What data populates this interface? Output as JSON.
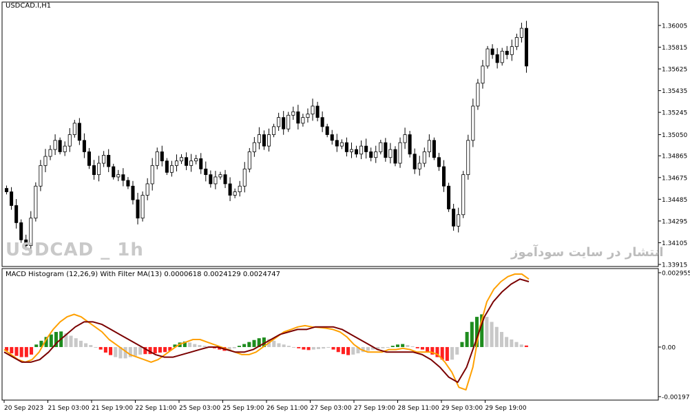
{
  "window": {
    "symbol_title": "USDCAD.I,H1",
    "watermark_left": "USDCAD _ 1h",
    "watermark_right": "انتشار در سایت سودآموز"
  },
  "colors": {
    "background": "#ffffff",
    "axis": "#000000",
    "candle": "#000000",
    "hist_green": "#1e8c1e",
    "hist_red": "#ff2020",
    "hist_grey": "#c8c8c8",
    "macd_line": "#ffa000",
    "signal_line": "#7a0000"
  },
  "chart_data": [
    {
      "type": "candlestick",
      "title": "USDCAD.I,H1",
      "yticks": [
        "1.36005",
        "1.35815",
        "1.35625",
        "1.35435",
        "1.35245",
        "1.35050",
        "1.34865",
        "1.34675",
        "1.34485",
        "1.34295",
        "1.34105",
        "1.33915"
      ],
      "ylim": [
        1.33915,
        1.36095
      ],
      "xticks": [
        "20 Sep 2023",
        "21 Sep 03:00",
        "21 Sep 19:00",
        "22 Sep 11:00",
        "25 Sep 03:00",
        "25 Sep 19:00",
        "26 Sep 11:00",
        "27 Sep 03:00",
        "27 Sep 19:00",
        "28 Sep 11:00",
        "29 Sep 03:00",
        "29 Sep 19:00"
      ],
      "close_path": [
        1.3455,
        1.3443,
        1.3428,
        1.3413,
        1.3408,
        1.3432,
        1.346,
        1.3478,
        1.3486,
        1.3492,
        1.35,
        1.349,
        1.3495,
        1.3505,
        1.3515,
        1.35,
        1.349,
        1.3478,
        1.347,
        1.348,
        1.3487,
        1.3477,
        1.3468,
        1.347,
        1.3465,
        1.346,
        1.3448,
        1.3432,
        1.3452,
        1.3462,
        1.3478,
        1.349,
        1.3482,
        1.3472,
        1.3478,
        1.3482,
        1.3485,
        1.3478,
        1.3482,
        1.3484,
        1.3475,
        1.347,
        1.3462,
        1.3468,
        1.347,
        1.3462,
        1.3452,
        1.3455,
        1.346,
        1.3475,
        1.349,
        1.3498,
        1.3505,
        1.3495,
        1.3505,
        1.3512,
        1.352,
        1.351,
        1.3522,
        1.3525,
        1.3515,
        1.352,
        1.3523,
        1.353,
        1.352,
        1.3512,
        1.3505,
        1.35,
        1.3495,
        1.3498,
        1.349,
        1.3492,
        1.3488,
        1.3495,
        1.349,
        1.3485,
        1.349,
        1.3498,
        1.3485,
        1.3492,
        1.348,
        1.3498,
        1.3505,
        1.3488,
        1.3475,
        1.348,
        1.349,
        1.35,
        1.3485,
        1.3477,
        1.346,
        1.344,
        1.3425,
        1.3435,
        1.347,
        1.35,
        1.353,
        1.355,
        1.3565,
        1.358,
        1.3575,
        1.3568,
        1.3578,
        1.3575,
        1.3582,
        1.359,
        1.3598,
        1.3565
      ]
    },
    {
      "type": "bar",
      "title": "MACD Histogram (12,26,9) With Filter MA(13) 0.0000618 0.0024129 0.0024747",
      "yticks": [
        "0.0029552",
        "0.00",
        "-0.0019719"
      ],
      "ylim": [
        -0.0019719,
        0.0029552
      ],
      "histogram": [
        -0.00015,
        -0.00025,
        -0.00035,
        -0.0004,
        -0.0004,
        -0.0003,
        0.0001,
        0.00025,
        0.0004,
        0.0005,
        0.0006,
        0.00062,
        0.00055,
        0.00045,
        0.00035,
        0.00025,
        0.00015,
        8e-05,
        0.0,
        -0.0001,
        -0.00022,
        -0.00032,
        -0.0004,
        -0.00045,
        -0.00045,
        -0.0004,
        -0.00035,
        -0.0003,
        -0.00028,
        -0.00028,
        -0.00025,
        -0.00022,
        -0.0002,
        -0.00015,
        0.0001,
        0.00018,
        0.00022,
        0.00018,
        0.00012,
        8e-05,
        5e-05,
        0.0,
        -5e-05,
        -0.0001,
        -0.00015,
        -0.00012,
        -5e-05,
        5e-05,
        0.00012,
        0.0002,
        0.00028,
        0.00035,
        0.00038,
        0.00032,
        0.00025,
        0.00015,
        0.0001,
        5e-05,
        0.0,
        -5e-05,
        -0.0001,
        -0.00012,
        -0.0001,
        -8e-05,
        -6e-05,
        -3e-05,
        -0.0001,
        -0.0002,
        -0.00028,
        -0.00032,
        -0.0003,
        -0.00025,
        -0.0002,
        -0.00015,
        -0.0001,
        -8e-05,
        -5e-05,
        -3e-05,
        5e-05,
        0.0001,
        0.00012,
        8e-05,
        3e-05,
        -5e-05,
        -0.0001,
        -0.00018,
        -0.0003,
        -0.0004,
        -0.0005,
        -0.00055,
        -0.0005,
        -0.0003,
        0.0002,
        0.0006,
        0.001,
        0.0012,
        0.0013,
        0.0012,
        0.001,
        0.0008,
        0.0006,
        0.0004,
        0.0003,
        0.0002,
        0.0001,
        6e-05
      ],
      "hist_colors": [
        "red",
        "red",
        "red",
        "red",
        "red",
        "red",
        "green",
        "green",
        "green",
        "green",
        "green",
        "green",
        "grey",
        "grey",
        "grey",
        "grey",
        "grey",
        "grey",
        "grey",
        "red",
        "red",
        "red",
        "grey",
        "grey",
        "grey",
        "grey",
        "grey",
        "grey",
        "red",
        "red",
        "red",
        "red",
        "red",
        "red",
        "green",
        "green",
        "green",
        "grey",
        "grey",
        "grey",
        "grey",
        "grey",
        "red",
        "red",
        "red",
        "grey",
        "grey",
        "green",
        "green",
        "green",
        "green",
        "green",
        "green",
        "grey",
        "grey",
        "grey",
        "grey",
        "grey",
        "grey",
        "red",
        "red",
        "red",
        "grey",
        "grey",
        "grey",
        "grey",
        "red",
        "red",
        "red",
        "red",
        "grey",
        "grey",
        "grey",
        "grey",
        "grey",
        "grey",
        "grey",
        "grey",
        "green",
        "green",
        "green",
        "grey",
        "grey",
        "red",
        "red",
        "red",
        "red",
        "red",
        "red",
        "red",
        "grey",
        "grey",
        "green",
        "green",
        "green",
        "green",
        "green",
        "grey",
        "grey",
        "grey",
        "grey",
        "grey",
        "grey",
        "grey",
        "grey",
        "red"
      ],
      "macd_line": [
        -0.0001,
        -0.0003,
        -0.0005,
        -0.0006,
        -0.0005,
        -0.0002,
        0.0003,
        0.0007,
        0.001,
        0.0012,
        0.0013,
        0.0012,
        0.001,
        0.0008,
        0.0006,
        0.0003,
        0.0001,
        -0.0001,
        -0.0003,
        -0.0004,
        -0.0005,
        -0.0006,
        -0.0005,
        -0.0003,
        -0.0001,
        0.0001,
        0.0002,
        0.0003,
        0.0003,
        0.0002,
        0.0001,
        0.0,
        -0.0001,
        -0.0002,
        -0.0003,
        -0.0003,
        -0.0002,
        0.0,
        0.0002,
        0.0004,
        0.0006,
        0.0007,
        0.0008,
        0.00085,
        0.0008,
        0.00078,
        0.00075,
        0.0007,
        0.0006,
        0.0004,
        0.0001,
        -0.0001,
        -0.0002,
        -0.0002,
        -0.0002,
        -0.0001,
        -0.0001,
        -5e-05,
        -0.0001,
        -0.0002,
        -0.0002,
        -0.0002,
        -0.0003,
        -0.0006,
        -0.001,
        -0.0016,
        -0.0017,
        -0.0008,
        0.0008,
        0.0018,
        0.0023,
        0.0026,
        0.0028,
        0.0029,
        0.0029,
        0.0027
      ],
      "signal_line": [
        -0.0002,
        -0.0004,
        -0.0006,
        -0.0006,
        -0.0005,
        -0.0002,
        0.0002,
        0.0005,
        0.0008,
        0.001,
        0.001,
        0.0009,
        0.0007,
        0.0005,
        0.0003,
        0.0001,
        -0.0001,
        -0.0003,
        -0.0004,
        -0.0004,
        -0.0003,
        -0.0002,
        -0.0001,
        0.0,
        0.0,
        -0.0001,
        -0.0002,
        -0.0002,
        -0.0001,
        0.0001,
        0.0003,
        0.0005,
        0.0006,
        0.0007,
        0.0007,
        0.0008,
        0.0008,
        0.0008,
        0.0007,
        0.0005,
        0.0003,
        0.0001,
        -0.0001,
        -0.0002,
        -0.0002,
        -0.0002,
        -0.0002,
        -0.0003,
        -0.0005,
        -0.0008,
        -0.0012,
        -0.0014,
        -0.0008,
        0.0002,
        0.0012,
        0.0018,
        0.0022,
        0.0025,
        0.0027,
        0.0026
      ]
    }
  ]
}
